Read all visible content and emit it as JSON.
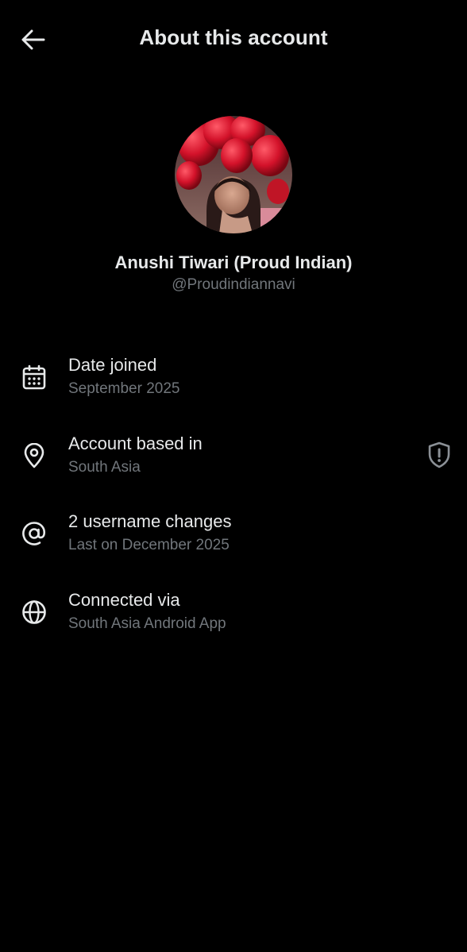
{
  "header": {
    "title": "About this account",
    "back_icon": "arrow-left-icon"
  },
  "profile": {
    "display_name": "Anushi Tiwari (Proud Indian)",
    "handle": "@Proudindiannavi",
    "avatar_icon": "avatar-photo"
  },
  "info": {
    "items": [
      {
        "icon": "calendar-icon",
        "title": "Date joined",
        "subtitle": "September 2025"
      },
      {
        "icon": "location-pin-icon",
        "title": "Account based in",
        "subtitle": "South Asia",
        "trailing_icon": "shield-alert-icon"
      },
      {
        "icon": "at-sign-icon",
        "title": "2 username changes",
        "subtitle": "Last on December 2025"
      },
      {
        "icon": "globe-icon",
        "title": "Connected via",
        "subtitle": "South Asia Android App"
      }
    ]
  },
  "colors": {
    "background": "#000000",
    "primary_text": "#e7e9ea",
    "secondary_text": "#71767b"
  }
}
